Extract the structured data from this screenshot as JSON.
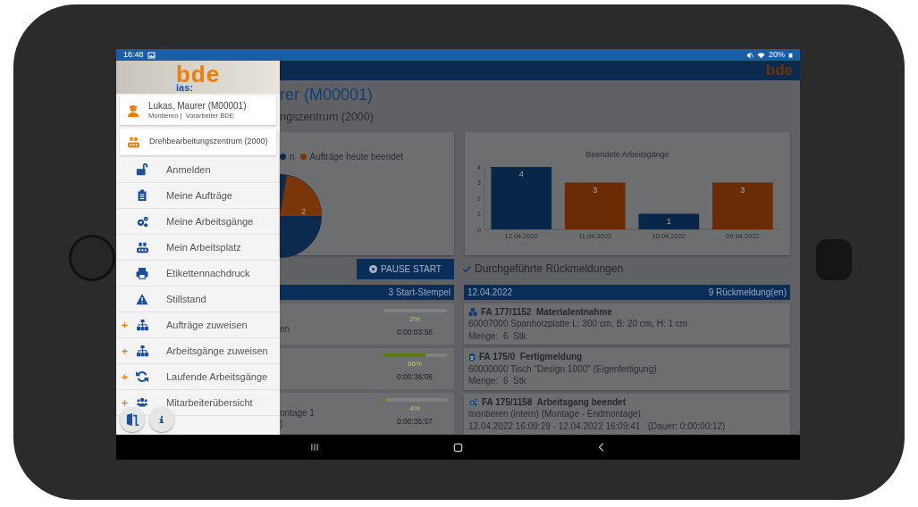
{
  "status_bar": {
    "time": "16:48",
    "battery": "20%"
  },
  "drawer": {
    "logo": {
      "main": "bde",
      "sub": "ias:"
    },
    "user": {
      "name": "Lukas, Maurer (M00001)",
      "role": "Montieren |  Vorarbeiter BDE"
    },
    "workplace": "Drehbearbeitungszentrum (2000)",
    "items": [
      {
        "label": "Anmelden",
        "expandable": false
      },
      {
        "label": "Meine Aufträge",
        "expandable": false
      },
      {
        "label": "Meine Arbeitsgänge",
        "expandable": false
      },
      {
        "label": "Mein Arbeitsplatz",
        "expandable": false
      },
      {
        "label": "Etikettennachdruck",
        "expandable": false
      },
      {
        "label": "Stillstand",
        "expandable": false
      },
      {
        "label": "Aufträge zuweisen",
        "expandable": true
      },
      {
        "label": "Arbeitsgänge zuweisen",
        "expandable": true
      },
      {
        "label": "Laufende Arbeitsgänge",
        "expandable": true
      },
      {
        "label": "Mitarbeiterübersicht",
        "expandable": true
      }
    ]
  },
  "app_bar": {
    "logo": "bde"
  },
  "header": {
    "title": "rer (M00001)",
    "subtitle": "ngszentrum (2000)"
  },
  "pie_card": {
    "legend": [
      {
        "label": "n",
        "color": "#0b2a4e"
      },
      {
        "label": "Aufträge heute beendet",
        "color": "#7a3608"
      }
    ],
    "slice_label": "2"
  },
  "bar_card": {
    "chart_data": {
      "type": "bar",
      "title": "Beendete Arbeitsgänge",
      "categories": [
        "12.04.2022",
        "11.04.2022",
        "10.04.2022",
        "09.04.2022"
      ],
      "series": [
        {
          "values": [
            4,
            3,
            1,
            3
          ]
        }
      ],
      "colors": [
        "#072648",
        "#6a2c04",
        "#072648",
        "#6a2c04"
      ],
      "ylim": [
        0,
        4
      ],
      "yticks": [
        0,
        1,
        2,
        3,
        4
      ],
      "data_labels": true
    }
  },
  "pause_button": "PAUSE START",
  "feedback_title": "Durchgeführte Rückmeldungen",
  "stamps": {
    "count": "3 Start-Stempel",
    "rows": [
      {
        "lines": [
          "en"
        ],
        "level": 0.02,
        "percent": "2%",
        "time": "0:00:03:56"
      },
      {
        "level": 0.66,
        "percent": "66%",
        "time": "0:00:36:06"
      },
      {
        "lines": [
          "ontage 1",
          ")"
        ],
        "level": 0.04,
        "percent": "4%",
        "time": "0:00:35:57"
      }
    ]
  },
  "feedback": {
    "date": "12.04.2022",
    "count": "9 Rückmeldung(en)",
    "entries": [
      {
        "kind": "material",
        "title": "FA 177/1152  Materialentnahme",
        "lines": [
          "60007000 Spanholzplatte L: 300 cm, B: 20 cm, H: 1 cm",
          "Menge:  6  Stk"
        ]
      },
      {
        "kind": "finished",
        "title": "FA 175/0  Fertigmeldung",
        "lines": [
          "60000000 Tisch \"Design 1000\" (Eigenfertigung)",
          "Menge:  6  Stk"
        ]
      },
      {
        "kind": "operation",
        "title": "FA 175/1158  Arbeitsgang beendet",
        "lines": [
          "montieren (intern) (Montage - Endmontage)",
          "12.04.2022 16:09:29 - 12.04.2022 16:09:41   (Dauer: 0:00:00:12)"
        ]
      }
    ]
  }
}
